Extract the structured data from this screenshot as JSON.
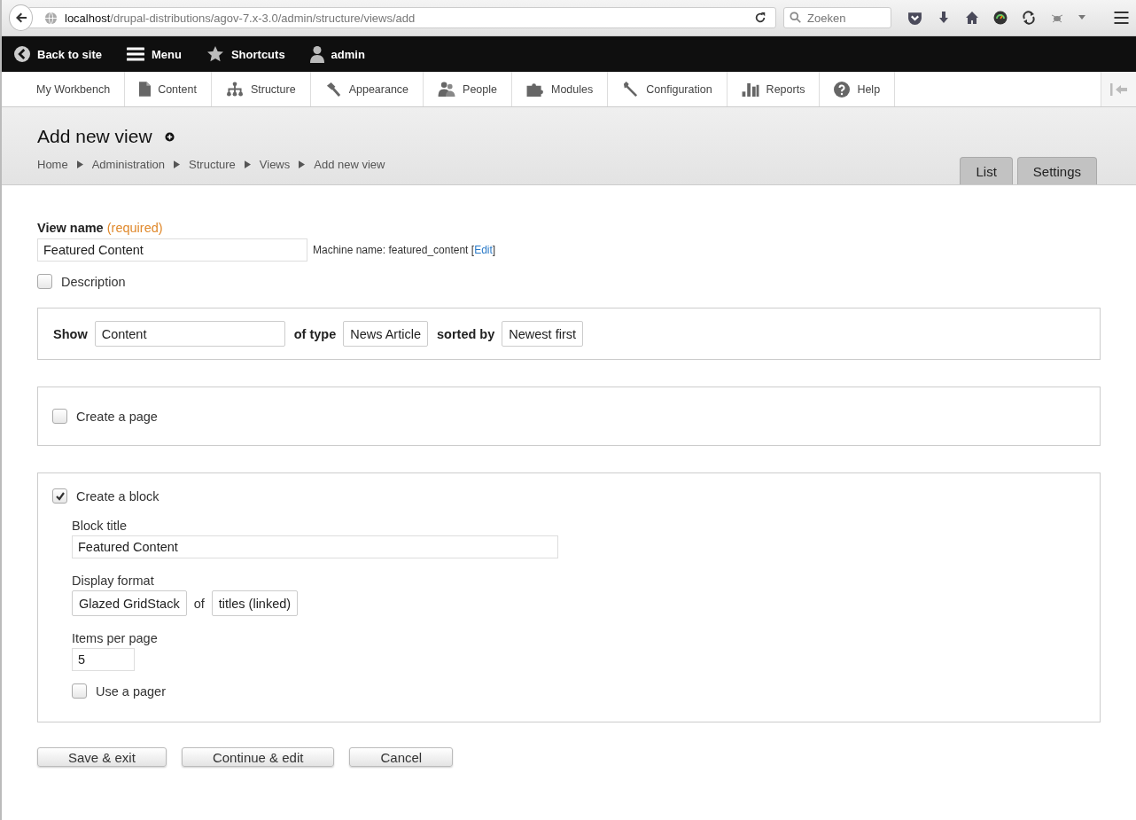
{
  "browser": {
    "url_host": "localhost",
    "url_path": "/drupal-distributions/agov-7.x-3.0/admin/structure/views/add",
    "search_placeholder": "Zoeken"
  },
  "admin_bar": [
    {
      "label": "Back to site"
    },
    {
      "label": "Menu"
    },
    {
      "label": "Shortcuts"
    },
    {
      "label": "admin"
    }
  ],
  "tray": [
    {
      "label": "My Workbench"
    },
    {
      "label": "Content"
    },
    {
      "label": "Structure"
    },
    {
      "label": "Appearance"
    },
    {
      "label": "People"
    },
    {
      "label": "Modules"
    },
    {
      "label": "Configuration"
    },
    {
      "label": "Reports"
    },
    {
      "label": "Help"
    }
  ],
  "header": {
    "title": "Add new view",
    "breadcrumb": [
      "Home",
      "Administration",
      "Structure",
      "Views",
      "Add new view"
    ],
    "tabs": [
      {
        "label": "List",
        "selected": false
      },
      {
        "label": "Settings",
        "selected": false
      }
    ]
  },
  "form": {
    "view_name_label": "View name",
    "required": "(required)",
    "view_name": "Featured Content",
    "machine_name": "Machine name: featured_content",
    "machine_edit": "Edit",
    "bracket_open": "[",
    "bracket_close": "]",
    "description": {
      "label": "Description",
      "checked": false
    },
    "show": [
      {
        "label": "Show",
        "value": "Content"
      },
      {
        "label": "of type",
        "value": "News Article"
      },
      {
        "label": "sorted by",
        "value": "Newest first"
      }
    ],
    "create_page": {
      "label": "Create a page",
      "checked": false
    },
    "create_block": {
      "label": "Create a block",
      "checked": true
    },
    "block_title_label": "Block title",
    "block_title": "Featured Content",
    "display_format_label": "Display format",
    "display_format": "Glazed GridStack",
    "of": "of",
    "display_of": "titles (linked)",
    "items_label": "Items per page",
    "items": "5",
    "use_pager": {
      "label": "Use a pager",
      "checked": false
    }
  },
  "buttons": [
    "Save & exit",
    "Continue & edit",
    "Cancel"
  ]
}
